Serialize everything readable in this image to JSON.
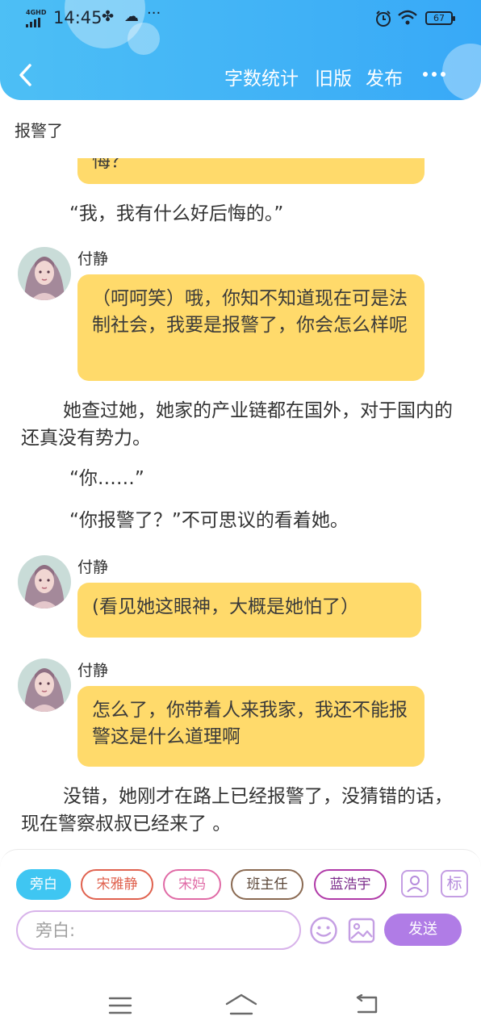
{
  "status_bar": {
    "network": "4GHD",
    "time": "14:45",
    "battery": "67"
  },
  "header": {
    "nav_items": [
      "字数统计",
      "旧版",
      "发布"
    ]
  },
  "page_title": "报警了",
  "story": {
    "partial_bubble_text": "悔？",
    "items": [
      {
        "type": "narration",
        "text": "“我，我有什么好后悔的。”"
      },
      {
        "type": "dialogue",
        "speaker": "付静",
        "text": "（呵呵笑）哦，你知不知道现在可是法制社会，我要是报警了，你会怎么样呢"
      },
      {
        "type": "narration",
        "text": "她查过她，她家的产业链都在国外，对于国内的还真没有势力。"
      },
      {
        "type": "narration",
        "text": "“你……”"
      },
      {
        "type": "narration",
        "text": "“你报警了？”不可思议的看着她。"
      },
      {
        "type": "dialogue",
        "speaker": "付静",
        "text": "(看见她这眼神，大概是她怕了）"
      },
      {
        "type": "dialogue",
        "speaker": "付静",
        "text": "怎么了，你带着人来我家，我还不能报警这是什么道理啊"
      },
      {
        "type": "narration",
        "text": "没错，她刚才在路上已经报警了，没猜错的话，现在警察叔叔已经来了 。"
      }
    ]
  },
  "characters": [
    {
      "name": "旁白",
      "selected": true,
      "color": "#3fc6f2"
    },
    {
      "name": "宋雅静",
      "selected": false,
      "color": "#e0624f"
    },
    {
      "name": "宋妈",
      "selected": false,
      "color": "#e06ba6"
    },
    {
      "name": "班主任",
      "selected": false,
      "color": "#8a6a52"
    },
    {
      "name": "蓝浩宇",
      "selected": false,
      "color": "#b03aa8"
    }
  ],
  "composer": {
    "tag_label": "标",
    "placeholder": "旁白:",
    "send_label": "发送"
  },
  "colors": {
    "header": "#3eb2f6",
    "bubble": "#ffda6b",
    "accent_purple": "#b07ce6"
  }
}
